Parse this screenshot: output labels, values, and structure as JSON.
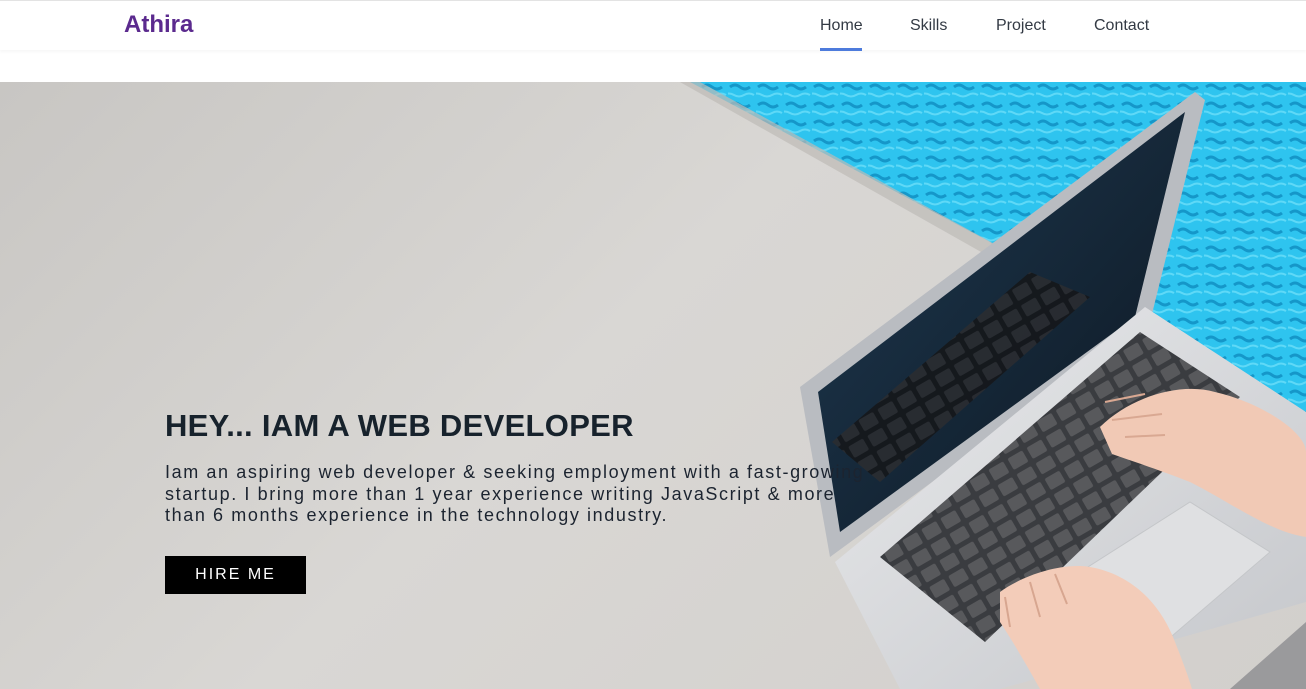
{
  "navbar": {
    "brand": "Athira",
    "links": [
      {
        "label": "Home",
        "active": true
      },
      {
        "label": "Skills",
        "active": false
      },
      {
        "label": "Project",
        "active": false
      },
      {
        "label": "Contact",
        "active": false
      }
    ]
  },
  "hero": {
    "heading": "HEY... IAM A WEB DEVELOPER",
    "description": "Iam an aspiring web developer & seeking employment with a fast-growing startup. I bring more than 1 year experience writing JavaScript & more than 6 months experience in the technology industry.",
    "cta_label": "HIRE ME",
    "background_image": "laptop-on-table-poolside-photo"
  },
  "colors": {
    "brand": "#5b2a8e",
    "nav_active_underline": "#4d7bdc",
    "heading": "#17222c",
    "button_bg": "#000000",
    "button_text": "#ffffff"
  }
}
